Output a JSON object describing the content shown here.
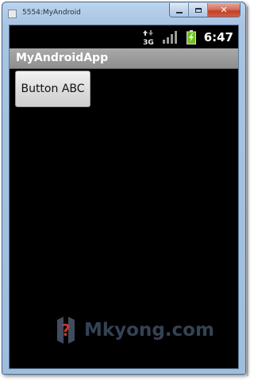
{
  "window": {
    "title": "5554:MyAndroid",
    "minimize_icon": "minimize-icon",
    "maximize_icon": "maximize-icon",
    "close_label": "✕"
  },
  "statusbar": {
    "network_label": "3G",
    "time": "6:47",
    "icons": [
      "network-3g-icon",
      "signal-icon",
      "battery-charging-icon"
    ]
  },
  "app": {
    "title": "MyAndroidApp",
    "button_label": "Button ABC"
  },
  "watermark": {
    "text": "Mkyong.com",
    "logo_icon": "mkyong-logo"
  },
  "colors": {
    "screen_background": "#000000",
    "app_titlebar": "#999999",
    "button_background": "#e0e0e0",
    "battery_green": "#7ed321",
    "watermark_blue": "#3a4a5e",
    "watermark_red": "#c0392b"
  }
}
